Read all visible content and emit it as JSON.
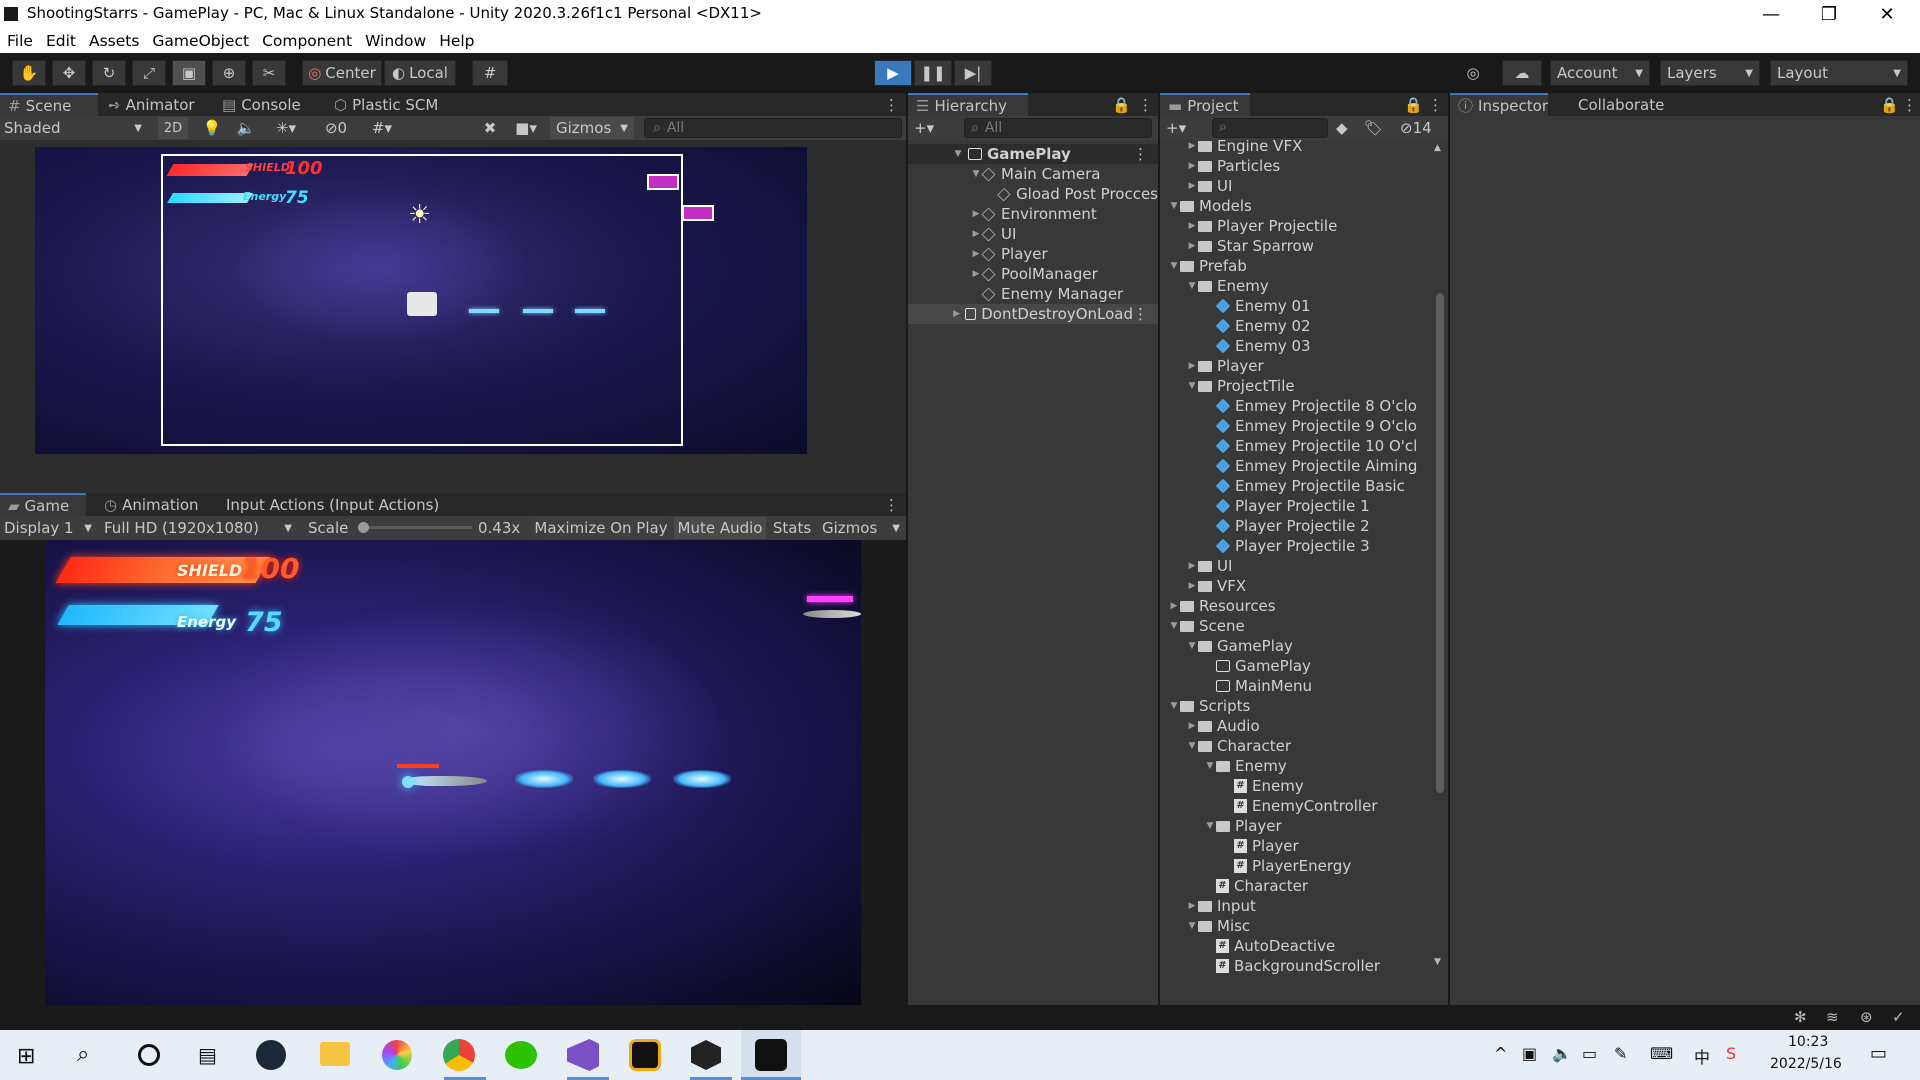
{
  "window": {
    "title": "ShootingStarrs - GamePlay - PC, Mac & Linux Standalone - Unity 2020.3.26f1c1 Personal <DX11>",
    "minimize_glyph": "—",
    "maximize_glyph": "❐",
    "close_glyph": "✕"
  },
  "menu": [
    "File",
    "Edit",
    "Assets",
    "GameObject",
    "Component",
    "Window",
    "Help"
  ],
  "toolbar": {
    "pivot_label": "Center",
    "space_label": "Local",
    "account_label": "Account",
    "layers_label": "Layers",
    "layout_label": "Layout"
  },
  "scene_panel": {
    "tabs": [
      "Scene",
      "Animator",
      "Console",
      "Plastic SCM"
    ],
    "shading": "Shaded",
    "mode_2d": "2D",
    "hidden_count": "0",
    "gizmos_label": "Gizmos",
    "search_placeholder": "All"
  },
  "scene_hud": {
    "shield_label": "SHIELD",
    "shield_value": "100",
    "energy_label": "Energy",
    "energy_value": "75"
  },
  "game_panel": {
    "tabs": [
      "Game",
      "Animation",
      "Input Actions (Input Actions)"
    ],
    "display": "Display 1",
    "resolution": "Full HD (1920x1080)",
    "scale_label": "Scale",
    "scale_value": "0.43x",
    "scale_fraction": 0.0,
    "maximize": "Maximize On Play",
    "mute": "Mute Audio",
    "stats": "Stats",
    "gizmos": "Gizmos",
    "hud": {
      "shield_label": "SHIELD",
      "shield_value": "100",
      "energy_label": "Energy",
      "energy_value": "75"
    }
  },
  "hierarchy": {
    "tab": "Hierarchy",
    "search_placeholder": "All",
    "scene": "GamePlay",
    "items": [
      {
        "label": "Main Camera",
        "depth": 1,
        "expanded": true
      },
      {
        "label": "Gload Post Procces",
        "depth": 2
      },
      {
        "label": "Environment",
        "depth": 1,
        "collapsed": true
      },
      {
        "label": "UI",
        "depth": 1,
        "collapsed": true
      },
      {
        "label": "Player",
        "depth": 1,
        "collapsed": true
      },
      {
        "label": "PoolManager",
        "depth": 1,
        "collapsed": true
      },
      {
        "label": "Enemy Manager",
        "depth": 1
      }
    ],
    "ddol": "DontDestroyOnLoad"
  },
  "project": {
    "tab": "Project",
    "hidden_count": "14",
    "items": [
      {
        "label": "Engine VFX",
        "depth": 2,
        "type": "folder",
        "arrow": "closed"
      },
      {
        "label": "Particles",
        "depth": 2,
        "type": "folder",
        "arrow": "closed"
      },
      {
        "label": "UI",
        "depth": 2,
        "type": "folder",
        "arrow": "closed"
      },
      {
        "label": "Models",
        "depth": 1,
        "type": "folder",
        "arrow": "open"
      },
      {
        "label": "Player Projectile",
        "depth": 2,
        "type": "folder",
        "arrow": "closed"
      },
      {
        "label": "Star Sparrow",
        "depth": 2,
        "type": "folder",
        "arrow": "closed"
      },
      {
        "label": "Prefab",
        "depth": 1,
        "type": "folder",
        "arrow": "open"
      },
      {
        "label": "Enemy",
        "depth": 2,
        "type": "folder",
        "arrow": "open"
      },
      {
        "label": "Enemy 01",
        "depth": 3,
        "type": "prefab"
      },
      {
        "label": "Enemy 02",
        "depth": 3,
        "type": "prefab"
      },
      {
        "label": "Enemy 03",
        "depth": 3,
        "type": "prefab"
      },
      {
        "label": "Player",
        "depth": 2,
        "type": "folder",
        "arrow": "closed"
      },
      {
        "label": "ProjectTile",
        "depth": 2,
        "type": "folder",
        "arrow": "open"
      },
      {
        "label": "Enmey Projectile 8 O'clo",
        "depth": 3,
        "type": "prefab"
      },
      {
        "label": "Enmey Projectile 9 O'clo",
        "depth": 3,
        "type": "prefab"
      },
      {
        "label": "Enmey Projectile 10 O'cl",
        "depth": 3,
        "type": "prefab"
      },
      {
        "label": "Enmey Projectile Aiming",
        "depth": 3,
        "type": "prefab"
      },
      {
        "label": "Enmey Projectile Basic",
        "depth": 3,
        "type": "prefab"
      },
      {
        "label": "Player Projectile 1",
        "depth": 3,
        "type": "prefab"
      },
      {
        "label": "Player Projectile 2",
        "depth": 3,
        "type": "prefab"
      },
      {
        "label": "Player Projectile 3",
        "depth": 3,
        "type": "prefab"
      },
      {
        "label": "UI",
        "depth": 2,
        "type": "folder",
        "arrow": "closed"
      },
      {
        "label": "VFX",
        "depth": 2,
        "type": "folder",
        "arrow": "closed"
      },
      {
        "label": "Resources",
        "depth": 1,
        "type": "folder",
        "arrow": "closed"
      },
      {
        "label": "Scene",
        "depth": 1,
        "type": "folder",
        "arrow": "open"
      },
      {
        "label": "GamePlay",
        "depth": 2,
        "type": "folder",
        "arrow": "open"
      },
      {
        "label": "GamePlay",
        "depth": 3,
        "type": "scene"
      },
      {
        "label": "MainMenu",
        "depth": 3,
        "type": "scene"
      },
      {
        "label": "Scripts",
        "depth": 1,
        "type": "folder",
        "arrow": "open"
      },
      {
        "label": "Audio",
        "depth": 2,
        "type": "folder",
        "arrow": "closed"
      },
      {
        "label": "Character",
        "depth": 2,
        "type": "folder",
        "arrow": "open"
      },
      {
        "label": "Enemy",
        "depth": 3,
        "type": "folder",
        "arrow": "open"
      },
      {
        "label": "Enemy",
        "depth": 4,
        "type": "script"
      },
      {
        "label": "EnemyController",
        "depth": 4,
        "type": "script"
      },
      {
        "label": "Player",
        "depth": 3,
        "type": "folder",
        "arrow": "open"
      },
      {
        "label": "Player",
        "depth": 4,
        "type": "script"
      },
      {
        "label": "PlayerEnergy",
        "depth": 4,
        "type": "script"
      },
      {
        "label": "Character",
        "depth": 3,
        "type": "script"
      },
      {
        "label": "Input",
        "depth": 2,
        "type": "folder",
        "arrow": "closed"
      },
      {
        "label": "Misc",
        "depth": 2,
        "type": "folder",
        "arrow": "open"
      },
      {
        "label": "AutoDeactive",
        "depth": 3,
        "type": "script"
      },
      {
        "label": "BackgroundScroller",
        "depth": 3,
        "type": "script"
      }
    ]
  },
  "inspector": {
    "tab": "Inspector",
    "collab_tab": "Collaborate"
  },
  "taskbar": {
    "time": "10:23",
    "date": "2022/5/16"
  },
  "colors": {
    "accent_blue": "#3a79bb",
    "shield": "#ff3a2a",
    "energy": "#27d8ff",
    "prefab": "#4aa3e0"
  }
}
